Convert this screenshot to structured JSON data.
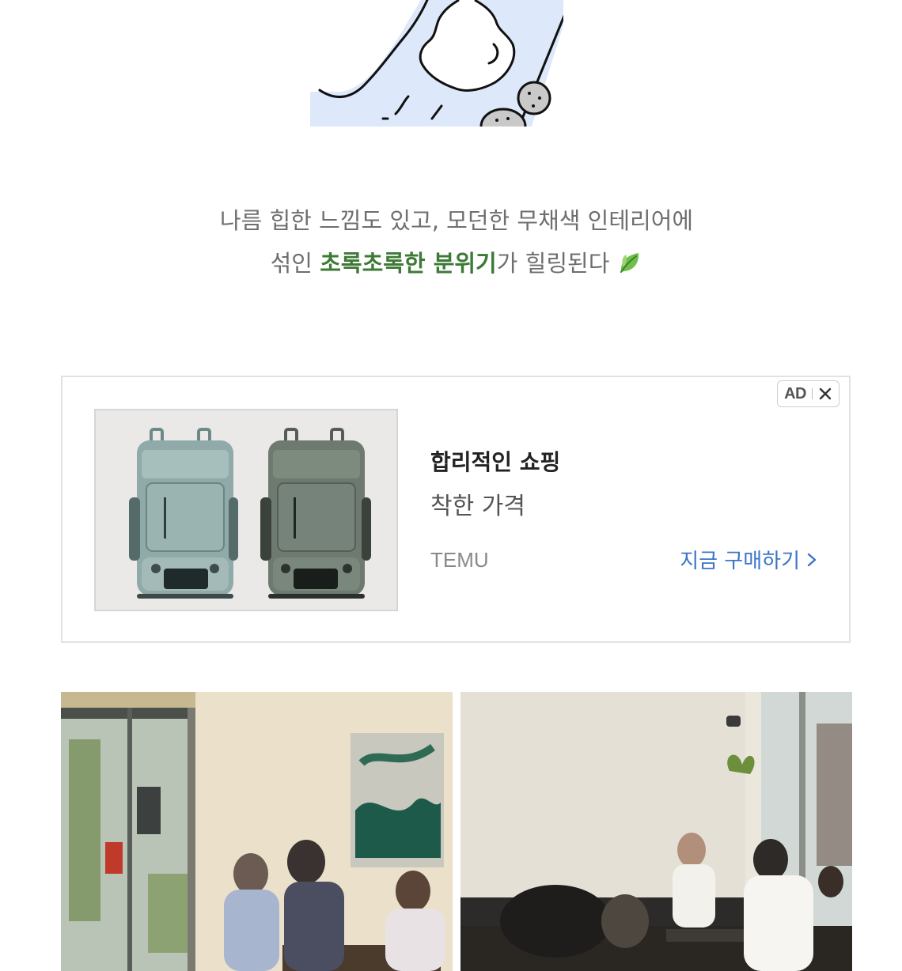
{
  "caption": {
    "line1": "나름 힙한 느낌도 있고, 모던한 무채색 인테리어에",
    "line2_prefix": "섞인 ",
    "line2_highlight": "초록초록한 분위기",
    "line2_suffix": "가 힐링된다",
    "emoji_icon": "leaf-icon",
    "highlight_color": "#3d7a36"
  },
  "ad": {
    "badge_label": "AD",
    "title": "합리적인 쇼핑",
    "subtitle": "착한 가격",
    "brand": "TEMU",
    "cta_label": "지금 구매하기",
    "cta_color": "#3b74c7",
    "image_icon": "backpack-product-image"
  },
  "photos": [
    {
      "name": "cafe-interior-photo-left"
    },
    {
      "name": "cafe-interior-photo-right"
    }
  ]
}
